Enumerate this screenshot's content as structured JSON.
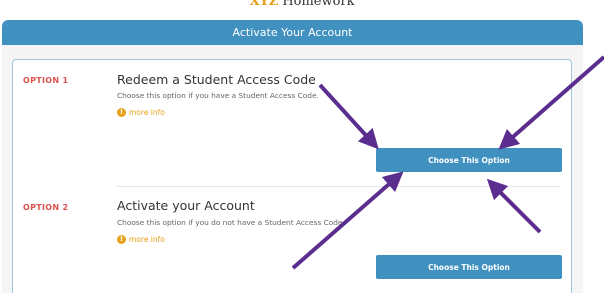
{
  "brand": {
    "prefix": "XYZ",
    "name": "Homework"
  },
  "header": {
    "title": "Activate Your Account"
  },
  "options": [
    {
      "label": "OPTION 1",
      "title": "Redeem a Student Access Code",
      "description": "Choose this option if you have a Student Access Code.",
      "more_info": "more info",
      "button": "Choose This Option"
    },
    {
      "label": "OPTION 2",
      "title": "Activate your Account",
      "description": "Choose this option if you do not have a Student Access Code.",
      "more_info": "more info",
      "button": "Choose This Option"
    }
  ],
  "colors": {
    "header_blue": "#4090c0",
    "option_label_red": "#d9534f",
    "more_info_orange": "#e5a11a",
    "annotation_arrow": "#5b2d8e"
  },
  "icons": {
    "info": "info-circle-icon"
  }
}
